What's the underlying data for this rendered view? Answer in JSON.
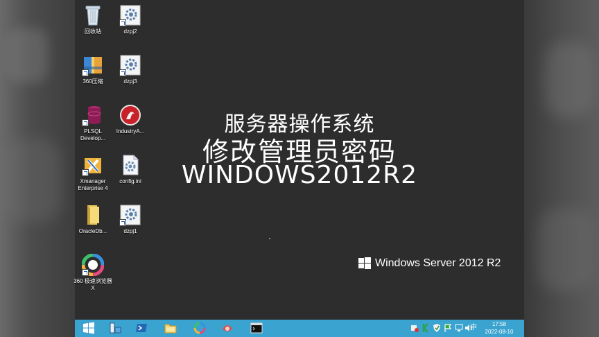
{
  "desktop_icons": [
    {
      "id": "recycle-bin",
      "label": "回收站"
    },
    {
      "id": "dzpj2",
      "label": "dzpj2"
    },
    {
      "id": "360zip",
      "label": "360压缩"
    },
    {
      "id": "dzpj3",
      "label": "dzpj3"
    },
    {
      "id": "plsql",
      "label": "PLSQL Develop..."
    },
    {
      "id": "industry",
      "label": "IndustryA..."
    },
    {
      "id": "xmanager",
      "label": "Xmanager Enterprise 4"
    },
    {
      "id": "config",
      "label": "config.ini"
    },
    {
      "id": "oracledb",
      "label": "OracleDb..."
    },
    {
      "id": "dzpj1",
      "label": "dzpj1"
    },
    {
      "id": "360browser",
      "label": "360 极速浏览器X"
    }
  ],
  "overlay": {
    "line1": "服务器操作系统",
    "line2": "修改管理员密码",
    "line3": "WINDOWS2012R2"
  },
  "brand": "Windows Server 2012 R2",
  "taskbar": {
    "ime": "中",
    "time": "17:58",
    "date": "2022-08-10"
  },
  "colors": {
    "taskbar": "#3aa3cf",
    "desktop": "#2d2d2d"
  }
}
